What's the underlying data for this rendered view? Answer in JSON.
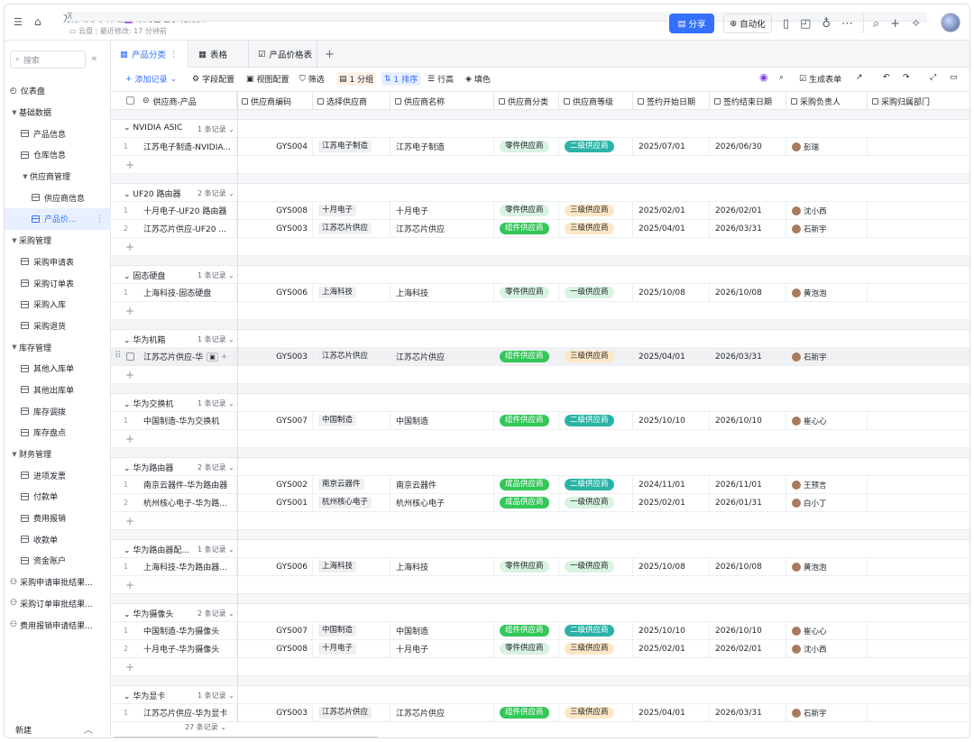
{
  "header": {
    "crumb1": "万涂幻象",
    "crumb2": "李祥瑞",
    "crumb3": "采购管理系统底表",
    "sub1": "云盘",
    "sub2": "最近修改: 17 分钟前",
    "share": "分享",
    "automation": "自动化"
  },
  "sidebar": {
    "search": "搜索",
    "new": "新建",
    "items": [
      {
        "label": "仪表盘",
        "type": "dash",
        "level": 0
      },
      {
        "label": "基础数据",
        "type": "folder",
        "level": 0
      },
      {
        "label": "产品信息",
        "type": "table",
        "level": 1
      },
      {
        "label": "仓库信息",
        "type": "table",
        "level": 1
      },
      {
        "label": "供应商管理",
        "type": "folder",
        "level": 1
      },
      {
        "label": "供应商信息",
        "type": "table",
        "level": 2
      },
      {
        "label": "产品价...",
        "type": "table",
        "level": 2,
        "active": true
      },
      {
        "label": "采购管理",
        "type": "folder",
        "level": 0
      },
      {
        "label": "采购申请表",
        "type": "table",
        "level": 1
      },
      {
        "label": "采购订单表",
        "type": "table",
        "level": 1
      },
      {
        "label": "采购入库",
        "type": "table",
        "level": 1
      },
      {
        "label": "采购退货",
        "type": "table",
        "level": 1
      },
      {
        "label": "库存管理",
        "type": "folder",
        "level": 0
      },
      {
        "label": "其他入库单",
        "type": "table",
        "level": 1
      },
      {
        "label": "其他出库单",
        "type": "table",
        "level": 1
      },
      {
        "label": "库存调拨",
        "type": "table",
        "level": 1
      },
      {
        "label": "库存盘点",
        "type": "table",
        "level": 1
      },
      {
        "label": "财务管理",
        "type": "folder",
        "level": 0
      },
      {
        "label": "进项发票",
        "type": "table",
        "level": 1
      },
      {
        "label": "付款单",
        "type": "table",
        "level": 1
      },
      {
        "label": "费用报销",
        "type": "table",
        "level": 1
      },
      {
        "label": "收款单",
        "type": "table",
        "level": 1
      },
      {
        "label": "资金账户",
        "type": "table",
        "level": 1
      },
      {
        "label": "采购申请审批结果...",
        "type": "flow",
        "level": 0
      },
      {
        "label": "采购订单审批结果...",
        "type": "flow",
        "level": 0
      },
      {
        "label": "费用报销申请结果...",
        "type": "flow",
        "level": 0
      }
    ]
  },
  "tabs": {
    "t1": "产品分类",
    "t2": "表格",
    "t3": "产品价格表"
  },
  "toolbar": {
    "add": "添加记录",
    "field": "字段配置",
    "view": "视图配置",
    "filter": "筛选",
    "group": "1 分组",
    "sort": "1 排序",
    "rowh": "行高",
    "fill": "填色",
    "form": "生成表单"
  },
  "columns": [
    "供应商-产品",
    "供应商编码",
    "选择供应商",
    "供应商名称",
    "供应商分类",
    "供应商等级",
    "签约开始日期",
    "签约结束日期",
    "采购负责人",
    "采购归属部门"
  ],
  "groups": [
    {
      "name": "NVIDIA ASIC",
      "count": "1 条记录",
      "rows": [
        {
          "n": "1",
          "prod": "江苏电子制造-NVIDIA...",
          "code": "GYS004",
          "sel": "江苏电子制造",
          "name": "江苏电子制造",
          "cat": "零件供应商",
          "level": "二级供应商",
          "start": "2025/07/01",
          "end": "2026/06/30",
          "owner": "彭瑞"
        }
      ]
    },
    {
      "name": "UF20 路由器",
      "count": "2 条记录",
      "rows": [
        {
          "n": "1",
          "prod": "十月电子-UF20 路由器",
          "code": "GYS008",
          "sel": "十月电子",
          "name": "十月电子",
          "cat": "零件供应商",
          "level": "三级供应商",
          "start": "2025/02/01",
          "end": "2026/02/01",
          "owner": "沈小西"
        },
        {
          "n": "2",
          "prod": "江苏芯片供应-UF20 ...",
          "code": "GYS003",
          "sel": "江苏芯片供应",
          "name": "江苏芯片供应",
          "cat": "组件供应商",
          "level": "三级供应商",
          "start": "2025/04/01",
          "end": "2026/03/31",
          "owner": "石新宇"
        }
      ]
    },
    {
      "name": "固态硬盘",
      "count": "1 条记录",
      "rows": [
        {
          "n": "1",
          "prod": "上海科技-固态硬盘",
          "code": "GYS006",
          "sel": "上海科技",
          "name": "上海科技",
          "cat": "零件供应商",
          "level": "一级供应商",
          "start": "2025/10/08",
          "end": "2026/10/08",
          "owner": "黄泡泡"
        }
      ]
    },
    {
      "name": "华为机箱",
      "count": "1 条记录",
      "rows": [
        {
          "n": "",
          "prod": "江苏芯片供应-华",
          "code": "GYS003",
          "sel": "江苏芯片供应",
          "name": "江苏芯片供应",
          "cat": "组件供应商",
          "level": "三级供应商",
          "start": "2025/04/01",
          "end": "2026/03/31",
          "owner": "石新宇",
          "selected": true
        }
      ]
    },
    {
      "name": "华为交换机",
      "count": "1 条记录",
      "rows": [
        {
          "n": "1",
          "prod": "中国制造-华为交换机",
          "code": "GYS007",
          "sel": "中国制造",
          "name": "中国制造",
          "cat": "组件供应商",
          "level": "二级供应商",
          "start": "2025/10/10",
          "end": "2026/10/10",
          "owner": "崔心心"
        }
      ]
    },
    {
      "name": "华为路由器",
      "count": "2 条记录",
      "rows": [
        {
          "n": "1",
          "prod": "南京云器件-华为路由器",
          "code": "GYS002",
          "sel": "南京云器件",
          "name": "南京云器件",
          "cat": "成品供应商",
          "level": "二级供应商",
          "start": "2024/11/01",
          "end": "2026/11/01",
          "owner": "王预言"
        },
        {
          "n": "2",
          "prod": "杭州核心电子-华为路...",
          "code": "GYS001",
          "sel": "杭州核心电子",
          "name": "杭州核心电子",
          "cat": "成品供应商",
          "level": "一级供应商",
          "start": "2025/02/01",
          "end": "2026/01/31",
          "owner": "白小丁"
        }
      ]
    },
    {
      "name": "华为路由器配...",
      "count": "1 条记录",
      "rows": [
        {
          "n": "1",
          "prod": "上海科技-华为路由器...",
          "code": "GYS006",
          "sel": "上海科技",
          "name": "上海科技",
          "cat": "零件供应商",
          "level": "一级供应商",
          "start": "2025/10/08",
          "end": "2026/10/08",
          "owner": "黄泡泡"
        }
      ]
    },
    {
      "name": "华为摄像头",
      "count": "2 条记录",
      "rows": [
        {
          "n": "1",
          "prod": "中国制造-华为摄像头",
          "code": "GYS007",
          "sel": "中国制造",
          "name": "中国制造",
          "cat": "组件供应商",
          "level": "二级供应商",
          "start": "2025/10/10",
          "end": "2026/10/10",
          "owner": "崔心心"
        },
        {
          "n": "2",
          "prod": "十月电子-华为摄像头",
          "code": "GYS008",
          "sel": "十月电子",
          "name": "十月电子",
          "cat": "零件供应商",
          "level": "三级供应商",
          "start": "2025/02/01",
          "end": "2026/02/01",
          "owner": "沈小西"
        }
      ]
    },
    {
      "name": "华为显卡",
      "count": "1 条记录",
      "rows": [
        {
          "n": "1",
          "prod": "江苏芯片供应-华为显卡",
          "code": "GYS003",
          "sel": "江苏芯片供应",
          "name": "江苏芯片供应",
          "cat": "组件供应商",
          "level": "三级供应商",
          "start": "2025/04/01",
          "end": "2026/03/31",
          "owner": "石新宇"
        }
      ]
    }
  ],
  "footer": "27 条记录"
}
